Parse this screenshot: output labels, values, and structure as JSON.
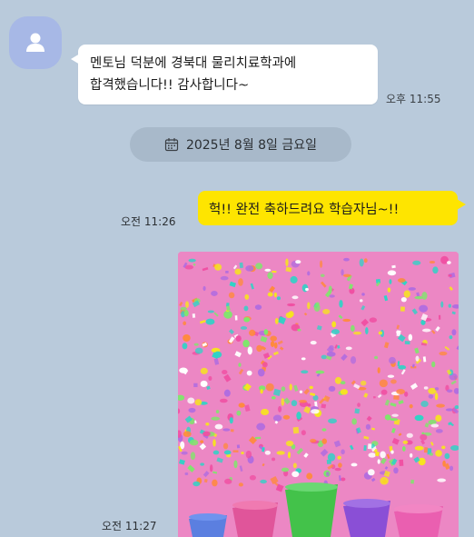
{
  "colors": {
    "background": "#b9cadb",
    "incoming_bubble": "#ffffff",
    "outgoing_bubble": "#fee500",
    "avatar": "#a7b8e6",
    "date_pill": "#a8b9ca",
    "photo_background": "#ec87c4"
  },
  "messages": {
    "incoming": {
      "line1": "멘토님 덕분에 경북대 물리치료학과에",
      "line2": "합격했습니다!! 감사합니다~",
      "time": "오후 11:55",
      "avatar_icon": "person-icon"
    },
    "date_divider": {
      "icon": "calendar-icon",
      "label": "2025년 8월 8일 금요일"
    },
    "outgoing_text": {
      "text": "헉!! 완전 축하드려요 학습자님~!!",
      "time": "오전 11:26"
    },
    "outgoing_image": {
      "time": "오전 11:27"
    }
  }
}
